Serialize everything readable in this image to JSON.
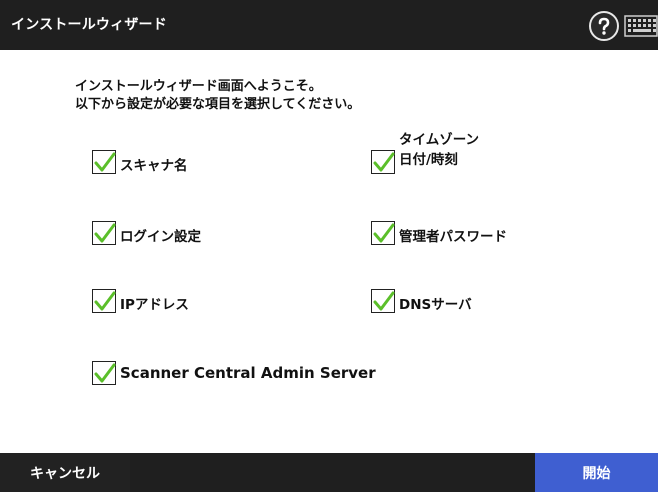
{
  "window": {
    "title": "インストールウィザード",
    "help_icon": "question-mark-icon",
    "keyboard_icon": "keyboard-icon"
  },
  "intro": {
    "line1": "インストールウィザード画面へようこそ。",
    "line2": "以下から設定が必要な項目を選択してください。"
  },
  "options": {
    "scanner_name": {
      "label": "スキャナ名",
      "checked": true
    },
    "timezone_datetime": {
      "line1": "タイムゾーン",
      "line2": "日付/時刻",
      "checked": true
    },
    "login_settings": {
      "label": "ログイン設定",
      "checked": true
    },
    "admin_password": {
      "label": "管理者パスワード",
      "checked": true
    },
    "ip_address": {
      "label": "IPアドレス",
      "checked": true
    },
    "dns_server": {
      "label": "DNSサーバ",
      "checked": true
    },
    "central_admin": {
      "label": "Scanner Central Admin Server",
      "checked": true
    }
  },
  "buttons": {
    "cancel": "キャンセル",
    "start": "開始"
  },
  "colors": {
    "titlebar": "#1f1f1f",
    "primary_button": "#3f5fd1",
    "check": "#5bbf2a"
  }
}
